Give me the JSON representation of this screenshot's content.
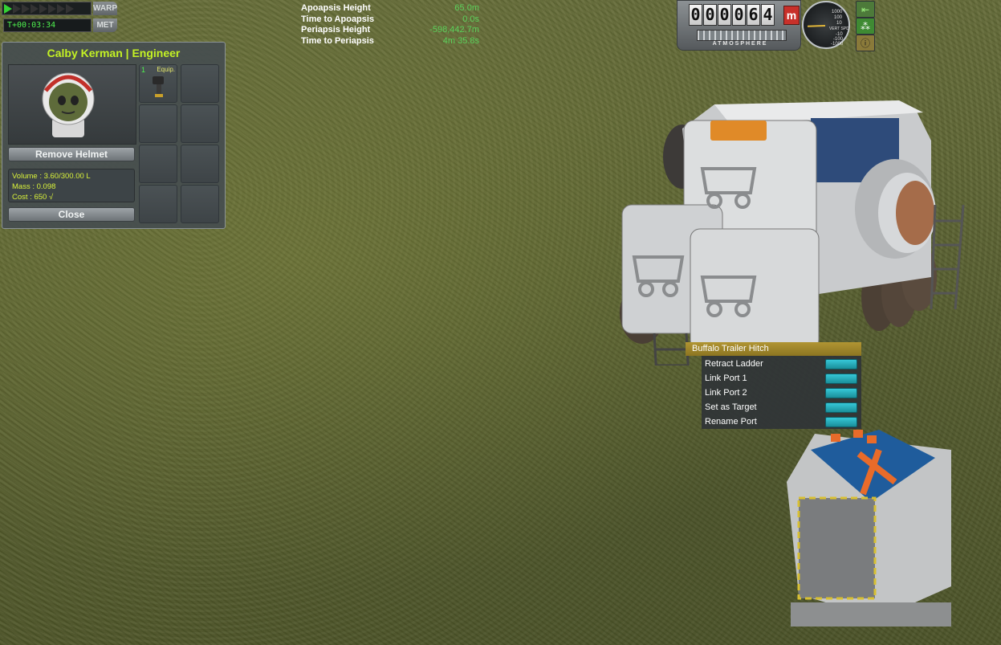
{
  "warp": {
    "label": "WARP",
    "met_label": "MET",
    "met_time": "T+00:03:34",
    "arrows_active": 1,
    "arrows_total": 8
  },
  "orbit": {
    "rows": [
      {
        "label": "Apoapsis Height",
        "value": "65.0m"
      },
      {
        "label": "Time to Apoapsis",
        "value": "0.0s"
      },
      {
        "label": "Periapsis Height",
        "value": "-598,442.7m"
      },
      {
        "label": "Time to Periapsis",
        "value": "4m 35.8s"
      }
    ]
  },
  "kerbal_panel": {
    "title": "Calby Kerman | Engineer",
    "remove_helmet": "Remove Helmet",
    "close": "Close",
    "stats": {
      "volume": "Volume : 3.60/300.00 L",
      "mass": "Mass : 0.098",
      "cost": "Cost : 650 √"
    },
    "inventory": [
      {
        "count": "1",
        "name": "Equip.",
        "filled": true
      },
      {
        "count": "",
        "name": "",
        "filled": false
      },
      {
        "count": "",
        "name": "",
        "filled": false
      },
      {
        "count": "",
        "name": "",
        "filled": false
      },
      {
        "count": "",
        "name": "",
        "filled": false
      },
      {
        "count": "",
        "name": "",
        "filled": false
      },
      {
        "count": "",
        "name": "",
        "filled": false
      },
      {
        "count": "",
        "name": "",
        "filled": false
      }
    ]
  },
  "altimeter": {
    "digits": [
      "0",
      "0",
      "0",
      "0",
      "6",
      "4"
    ],
    "unit": "m",
    "atmosphere_label": "ATMOSPHERE",
    "gauge_labels": [
      "1000",
      "100",
      "10",
      "VERT SPD",
      "-10",
      "-100",
      "-1000"
    ]
  },
  "context_menu": {
    "title": "Buffalo Trailer Hitch",
    "items": [
      "Retract Ladder",
      "Link Port 1",
      "Link Port 2",
      "Set as Target",
      "Rename Port"
    ]
  },
  "colors": {
    "accent_green": "#c4f224",
    "value_green": "#5bd15b",
    "menu_title": "#b09533",
    "menu_button": "#36c8d8"
  }
}
